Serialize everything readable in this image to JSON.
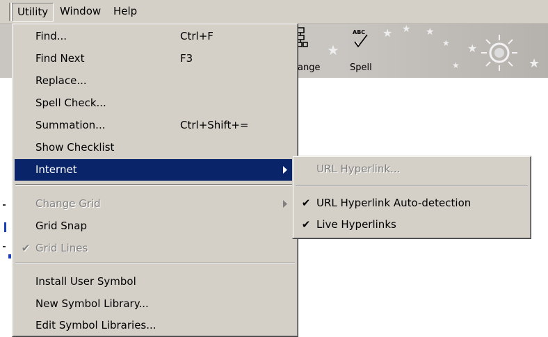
{
  "menubar": {
    "items": [
      {
        "label": "Utility"
      },
      {
        "label": "Window"
      },
      {
        "label": "Help"
      }
    ]
  },
  "toolbar": {
    "buttons": [
      {
        "label": "ange",
        "icon": "change-grid-icon"
      },
      {
        "label": "Spell",
        "icon": "spell-check-icon"
      }
    ],
    "spell_icon_text": "ABC"
  },
  "utility_menu": {
    "items": [
      {
        "label": "Find...",
        "shortcut": "Ctrl+F"
      },
      {
        "label": "Find Next",
        "shortcut": "F3"
      },
      {
        "label": "Replace...",
        "shortcut": ""
      },
      {
        "label": "Spell Check...",
        "shortcut": ""
      },
      {
        "label": "Summation...",
        "shortcut": "Ctrl+Shift+="
      },
      {
        "label": "Show Checklist",
        "shortcut": ""
      },
      {
        "label": "Internet",
        "shortcut": "",
        "submenu": true,
        "highlighted": true
      },
      {
        "label": "Change Grid",
        "shortcut": "",
        "submenu": true,
        "disabled": true
      },
      {
        "label": "Grid Snap",
        "shortcut": ""
      },
      {
        "label": "Grid Lines",
        "shortcut": "",
        "checked": true,
        "disabled": true
      },
      {
        "label": "Install User Symbol",
        "shortcut": ""
      },
      {
        "label": "New Symbol Library...",
        "shortcut": ""
      },
      {
        "label": "Edit Symbol Libraries...",
        "shortcut": ""
      }
    ]
  },
  "internet_submenu": {
    "items": [
      {
        "label": "URL Hyperlink...",
        "disabled": true
      },
      {
        "label": "URL Hyperlink Auto-detection",
        "checked": true
      },
      {
        "label": "Live Hyperlinks",
        "checked": true
      }
    ]
  },
  "colors": {
    "menu_face": "#d4d0c8",
    "highlight": "#0a246a",
    "highlight_text": "#ffffff",
    "disabled_text": "#808080"
  }
}
